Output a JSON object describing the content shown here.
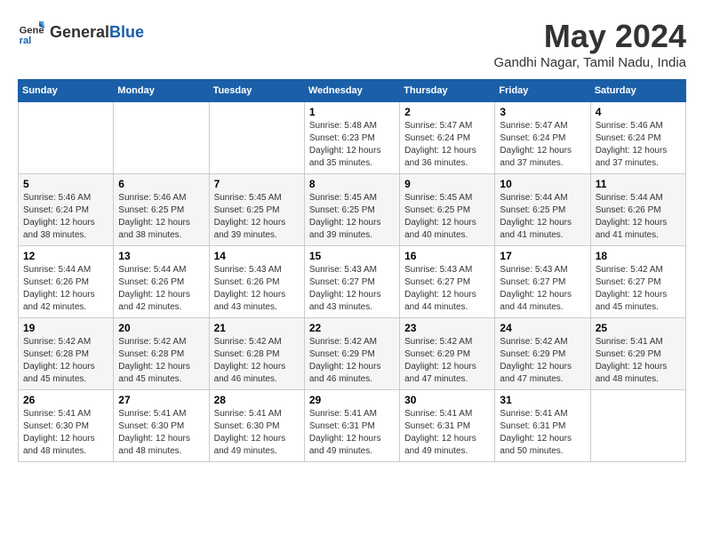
{
  "header": {
    "logo_general": "General",
    "logo_blue": "Blue",
    "month_title": "May 2024",
    "location": "Gandhi Nagar, Tamil Nadu, India"
  },
  "weekdays": [
    "Sunday",
    "Monday",
    "Tuesday",
    "Wednesday",
    "Thursday",
    "Friday",
    "Saturday"
  ],
  "weeks": [
    [
      {
        "day": "",
        "info": ""
      },
      {
        "day": "",
        "info": ""
      },
      {
        "day": "",
        "info": ""
      },
      {
        "day": "1",
        "info": "Sunrise: 5:48 AM\nSunset: 6:23 PM\nDaylight: 12 hours\nand 35 minutes."
      },
      {
        "day": "2",
        "info": "Sunrise: 5:47 AM\nSunset: 6:24 PM\nDaylight: 12 hours\nand 36 minutes."
      },
      {
        "day": "3",
        "info": "Sunrise: 5:47 AM\nSunset: 6:24 PM\nDaylight: 12 hours\nand 37 minutes."
      },
      {
        "day": "4",
        "info": "Sunrise: 5:46 AM\nSunset: 6:24 PM\nDaylight: 12 hours\nand 37 minutes."
      }
    ],
    [
      {
        "day": "5",
        "info": "Sunrise: 5:46 AM\nSunset: 6:24 PM\nDaylight: 12 hours\nand 38 minutes."
      },
      {
        "day": "6",
        "info": "Sunrise: 5:46 AM\nSunset: 6:25 PM\nDaylight: 12 hours\nand 38 minutes."
      },
      {
        "day": "7",
        "info": "Sunrise: 5:45 AM\nSunset: 6:25 PM\nDaylight: 12 hours\nand 39 minutes."
      },
      {
        "day": "8",
        "info": "Sunrise: 5:45 AM\nSunset: 6:25 PM\nDaylight: 12 hours\nand 39 minutes."
      },
      {
        "day": "9",
        "info": "Sunrise: 5:45 AM\nSunset: 6:25 PM\nDaylight: 12 hours\nand 40 minutes."
      },
      {
        "day": "10",
        "info": "Sunrise: 5:44 AM\nSunset: 6:25 PM\nDaylight: 12 hours\nand 41 minutes."
      },
      {
        "day": "11",
        "info": "Sunrise: 5:44 AM\nSunset: 6:26 PM\nDaylight: 12 hours\nand 41 minutes."
      }
    ],
    [
      {
        "day": "12",
        "info": "Sunrise: 5:44 AM\nSunset: 6:26 PM\nDaylight: 12 hours\nand 42 minutes."
      },
      {
        "day": "13",
        "info": "Sunrise: 5:44 AM\nSunset: 6:26 PM\nDaylight: 12 hours\nand 42 minutes."
      },
      {
        "day": "14",
        "info": "Sunrise: 5:43 AM\nSunset: 6:26 PM\nDaylight: 12 hours\nand 43 minutes."
      },
      {
        "day": "15",
        "info": "Sunrise: 5:43 AM\nSunset: 6:27 PM\nDaylight: 12 hours\nand 43 minutes."
      },
      {
        "day": "16",
        "info": "Sunrise: 5:43 AM\nSunset: 6:27 PM\nDaylight: 12 hours\nand 44 minutes."
      },
      {
        "day": "17",
        "info": "Sunrise: 5:43 AM\nSunset: 6:27 PM\nDaylight: 12 hours\nand 44 minutes."
      },
      {
        "day": "18",
        "info": "Sunrise: 5:42 AM\nSunset: 6:27 PM\nDaylight: 12 hours\nand 45 minutes."
      }
    ],
    [
      {
        "day": "19",
        "info": "Sunrise: 5:42 AM\nSunset: 6:28 PM\nDaylight: 12 hours\nand 45 minutes."
      },
      {
        "day": "20",
        "info": "Sunrise: 5:42 AM\nSunset: 6:28 PM\nDaylight: 12 hours\nand 45 minutes."
      },
      {
        "day": "21",
        "info": "Sunrise: 5:42 AM\nSunset: 6:28 PM\nDaylight: 12 hours\nand 46 minutes."
      },
      {
        "day": "22",
        "info": "Sunrise: 5:42 AM\nSunset: 6:29 PM\nDaylight: 12 hours\nand 46 minutes."
      },
      {
        "day": "23",
        "info": "Sunrise: 5:42 AM\nSunset: 6:29 PM\nDaylight: 12 hours\nand 47 minutes."
      },
      {
        "day": "24",
        "info": "Sunrise: 5:42 AM\nSunset: 6:29 PM\nDaylight: 12 hours\nand 47 minutes."
      },
      {
        "day": "25",
        "info": "Sunrise: 5:41 AM\nSunset: 6:29 PM\nDaylight: 12 hours\nand 48 minutes."
      }
    ],
    [
      {
        "day": "26",
        "info": "Sunrise: 5:41 AM\nSunset: 6:30 PM\nDaylight: 12 hours\nand 48 minutes."
      },
      {
        "day": "27",
        "info": "Sunrise: 5:41 AM\nSunset: 6:30 PM\nDaylight: 12 hours\nand 48 minutes."
      },
      {
        "day": "28",
        "info": "Sunrise: 5:41 AM\nSunset: 6:30 PM\nDaylight: 12 hours\nand 49 minutes."
      },
      {
        "day": "29",
        "info": "Sunrise: 5:41 AM\nSunset: 6:31 PM\nDaylight: 12 hours\nand 49 minutes."
      },
      {
        "day": "30",
        "info": "Sunrise: 5:41 AM\nSunset: 6:31 PM\nDaylight: 12 hours\nand 49 minutes."
      },
      {
        "day": "31",
        "info": "Sunrise: 5:41 AM\nSunset: 6:31 PM\nDaylight: 12 hours\nand 50 minutes."
      },
      {
        "day": "",
        "info": ""
      }
    ]
  ]
}
